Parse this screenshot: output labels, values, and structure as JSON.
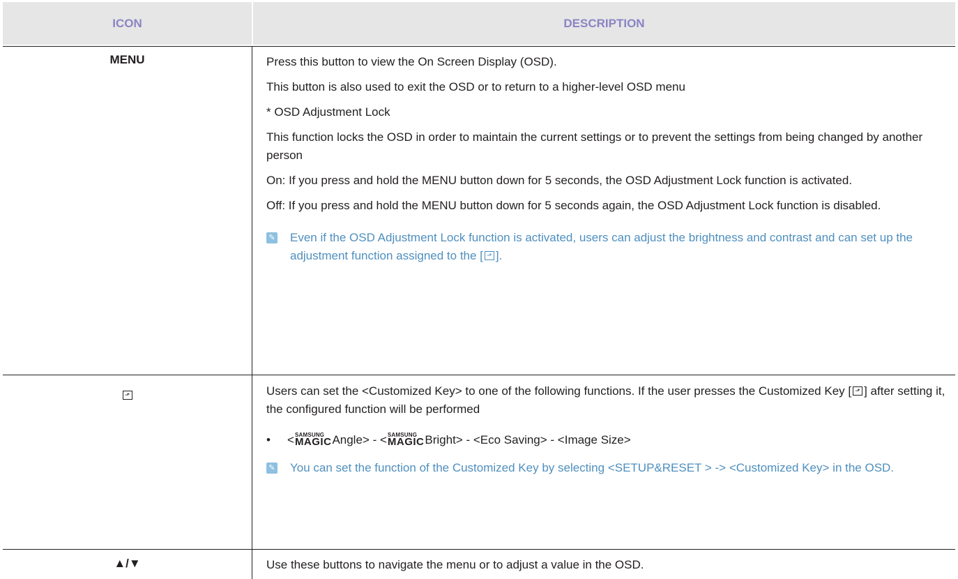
{
  "table": {
    "headers": {
      "icon": "ICON",
      "description": "DESCRIPTION"
    },
    "rows": {
      "menu": {
        "icon_label": "MENU",
        "p1": "Press this button to view the On Screen Display (OSD).",
        "p2": "This button is also used to exit the OSD or to return to a higher-level OSD menu",
        "p3": "* OSD Adjustment Lock",
        "p4": "This function locks the OSD in order to maintain the current settings or to prevent the settings from being changed by another person",
        "p5": "On: If you press and hold the MENU button down for 5 seconds, the OSD Adjustment Lock function is activated.",
        "p6": "Off: If you press and hold the MENU button down for 5 seconds again, the OSD Adjustment Lock function is disabled.",
        "note": "Even if the OSD Adjustment Lock function is activated, users can adjust the brightness and contrast and can set up the adjustment function assigned to the [",
        "note_end": "]."
      },
      "custom": {
        "p1a": "Users can set the <Customized Key> to one of the following functions. If the user presses the Customized Key [",
        "p1b": "] after setting it, the configured function will be performed",
        "bullet_a": "<",
        "magic_small": "SAMSUNG",
        "magic_big": "MAGIC",
        "bullet_b": "Angle> - <",
        "bullet_c": "Bright> - <Eco Saving> - <Image Size>",
        "note": "You can set the function of the Customized Key by selecting <SETUP&RESET > -> <Customized Key> in the OSD."
      },
      "arrows": {
        "icon_label": "▲/▼",
        "p1": "Use these buttons to navigate the menu or to adjust a value in the OSD."
      }
    },
    "glyphs": {
      "key_icon": "⬏",
      "note_icon": "✎",
      "bullet": "•"
    }
  },
  "colors": {
    "header_text": "#8b84c4",
    "header_bg": "#e6e6e6",
    "note_text": "#4f8fbe",
    "note_icon_bg": "#8ec0e0"
  }
}
